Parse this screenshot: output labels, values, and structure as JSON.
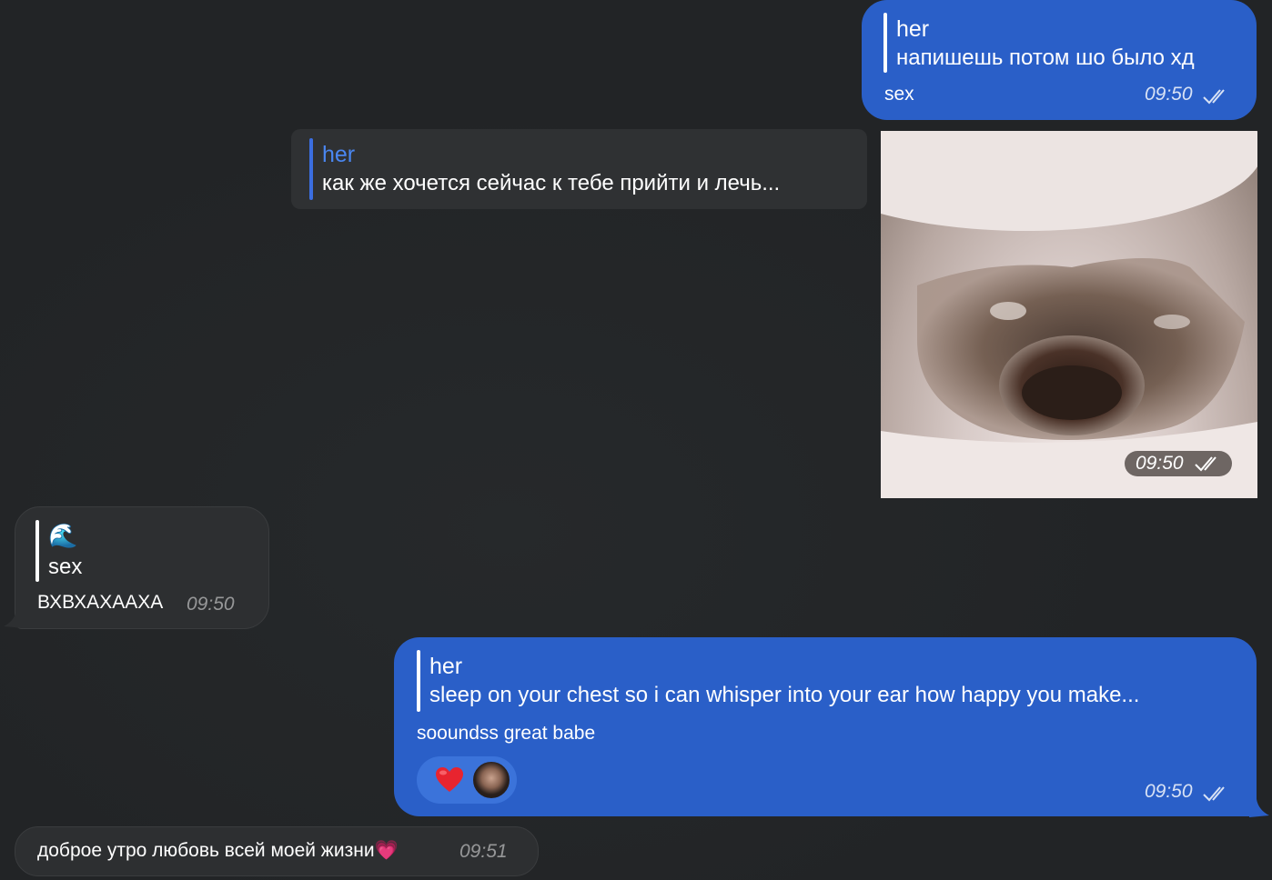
{
  "messages": {
    "m1": {
      "reply_name": "her",
      "reply_text": "напишешь потом шо было хд",
      "text": "sex",
      "time": "09:50"
    },
    "m2": {
      "reply_name": "her",
      "reply_text": "как же хочется сейчас к тебе прийти и лечь..."
    },
    "m3_photo": {
      "time": "09:50"
    },
    "m4": {
      "reply_emoji": "🌊",
      "reply_text": "sex",
      "text": "ВХВХАХААХА",
      "time": "09:50"
    },
    "m5": {
      "reply_name": "her",
      "reply_text": "sleep on your chest so i can whisper into your ear how happy you make...",
      "text": "sooundss great babe",
      "reaction_emoji": "❤️",
      "time": "09:50"
    },
    "m6": {
      "text": "доброе утро любовь всей моей жизни",
      "emoji": "💗",
      "time": "09:51"
    }
  },
  "colors": {
    "background": "#222426",
    "outgoing_bubble": "#2a5fc8",
    "incoming_bubble": "#2d2f31",
    "reply_accent": "#4a86f0"
  }
}
